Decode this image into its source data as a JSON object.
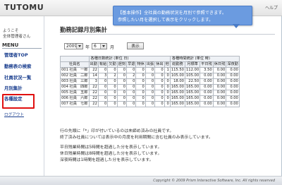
{
  "app": {
    "logo": "TUTOMU",
    "help": "ヘルプ"
  },
  "tooltip": {
    "line1": "【基本操作】全社員の勤務状況を月別で参照できます。",
    "line2": "参照したい月を選択して表示をクリックします。"
  },
  "sidebar": {
    "welcome_line1": "ようこそ",
    "welcome_line2": "全体管理者さん",
    "menu_title": "MENU",
    "items": [
      {
        "label": "管理者TOP"
      },
      {
        "label": "勤務表の検索"
      },
      {
        "label": "社員状況一覧"
      },
      {
        "label": "月別集計"
      },
      {
        "label": "各種設定"
      }
    ],
    "logout": "ログアウト"
  },
  "page": {
    "title": "勤務記録月別集計"
  },
  "filter": {
    "year_value": "2009",
    "year_unit": "年",
    "month_value": "6",
    "month_unit": "月",
    "show_button": "表示"
  },
  "table": {
    "group_day": "各種日数統計 (単位 日)",
    "group_time": "各種時間統計 (単位 時)",
    "headers": [
      "社員名",
      "出勤",
      "有給",
      "欠勤",
      "遅刻",
      "早退",
      "特休",
      "出張",
      "休出",
      "他",
      "総勤務",
      "月標準",
      "平日残",
      "休日残",
      "深夜勤"
    ],
    "rows": [
      [
        "001 社員　一郎",
        "22",
        "0",
        "0",
        "0",
        "0",
        "0",
        "0",
        "0",
        "1",
        "115.50",
        "112.00",
        "3.50",
        "0.00",
        "0.00"
      ],
      [
        "002 社員　二郎",
        "14",
        "3",
        "2",
        "0",
        "2",
        "0",
        "0",
        "0",
        "0",
        "105.00",
        "105.00",
        "0.00",
        "0.00",
        "0.00"
      ],
      [
        "003 社員　三郎",
        "3",
        "0",
        "0",
        "0",
        "0",
        "0",
        "0",
        "0",
        "0",
        "18.00",
        "22.50",
        "0.00",
        "0.00",
        "0.00"
      ],
      [
        "004 社員　四郎",
        "22",
        "0",
        "0",
        "0",
        "0",
        "0",
        "0",
        "0",
        "0",
        "165.00",
        "165.00",
        "0.00",
        "0.00",
        "0.00"
      ],
      [
        "005 社員　五郎",
        "22",
        "0",
        "0",
        "0",
        "0",
        "0",
        "0",
        "0",
        "0",
        "165.00",
        "165.00",
        "0.00",
        "0.00",
        "0.00"
      ],
      [
        "006 社員　六郎",
        "22",
        "0",
        "0",
        "0",
        "0",
        "0",
        "0",
        "0",
        "0",
        "165.00",
        "165.00",
        "0.00",
        "0.00",
        "0.00"
      ],
      [
        "007 社員　七郎",
        "22",
        "0",
        "0",
        "0",
        "0",
        "0",
        "0",
        "0",
        "0",
        "165.00",
        "165.00",
        "0.00",
        "0.00",
        "0.00"
      ]
    ]
  },
  "notes": {
    "line1": "行の先頭に「*」印が付いているのは未締め済みの社員です。",
    "line2": "終了済み社員については表示中の月度を利用期間に含む社員のみ表示しています。",
    "line3": "平日残業時間は5時間を超過した分を表示しています。",
    "line4": "休日残業時間は8時間を超過した分を表示しています。",
    "line5": "深夜時間は1時間を超過した分を表示しています。"
  },
  "footer": {
    "copyright": "Copyright © 2009 Prism Interactive Software, Inc. All rights reserved"
  },
  "colors": {
    "accent": "#6b9be0",
    "highlight": "#e01010",
    "link": "#1b3f8f"
  }
}
